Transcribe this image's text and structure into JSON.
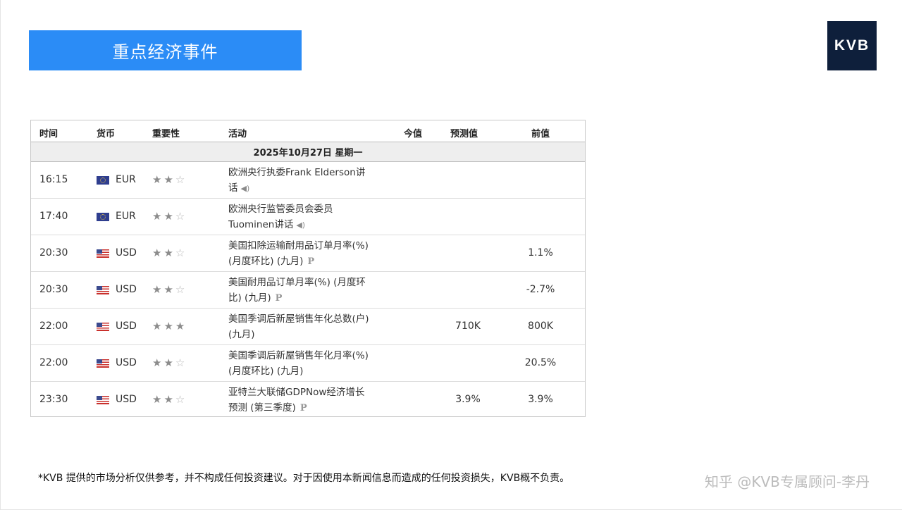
{
  "header": {
    "title": "重点经济事件",
    "logo": "KVB"
  },
  "table": {
    "columns": {
      "time": "时间",
      "currency": "货币",
      "importance": "重要性",
      "event": "活动",
      "actual": "今值",
      "forecast": "预测值",
      "previous": "前值"
    },
    "date": "2025年10月27日  星期一",
    "rows": [
      {
        "time": "16:15",
        "flag": "eu-flag-icon",
        "currency": "EUR",
        "importance": 2,
        "line1": "欧洲央行执委Frank Elderson讲",
        "line2": "话",
        "marker": "speaker-icon",
        "actual": "",
        "forecast": "",
        "previous": ""
      },
      {
        "time": "17:40",
        "flag": "eu-flag-icon",
        "currency": "EUR",
        "importance": 2,
        "line1": "欧洲央行监管委员会委员",
        "line2": "Tuominen讲话",
        "marker": "speaker-icon",
        "actual": "",
        "forecast": "",
        "previous": ""
      },
      {
        "time": "20:30",
        "flag": "us-flag-icon",
        "currency": "USD",
        "importance": 2,
        "line1": "美国扣除运输耐用品订单月率(%)",
        "line2": "(月度环比) (九月)",
        "marker": "preliminary-icon",
        "actual": "",
        "forecast": "",
        "previous": "1.1%"
      },
      {
        "time": "20:30",
        "flag": "us-flag-icon",
        "currency": "USD",
        "importance": 2,
        "line1": "美国耐用品订单月率(%) (月度环",
        "line2": "比) (九月)",
        "marker": "preliminary-icon",
        "actual": "",
        "forecast": "",
        "previous": "-2.7%"
      },
      {
        "time": "22:00",
        "flag": "us-flag-icon",
        "currency": "USD",
        "importance": 3,
        "line1": "美国季调后新屋销售年化总数(户)",
        "line2": "(九月)",
        "marker": "",
        "actual": "",
        "forecast": "710K",
        "previous": "800K"
      },
      {
        "time": "22:00",
        "flag": "us-flag-icon",
        "currency": "USD",
        "importance": 2,
        "line1": "美国季调后新屋销售年化月率(%)",
        "line2": "(月度环比) (九月)",
        "marker": "",
        "actual": "",
        "forecast": "",
        "previous": "20.5%"
      },
      {
        "time": "23:30",
        "flag": "us-flag-icon",
        "currency": "USD",
        "importance": 2,
        "line1": "亚特兰大联储GDPNow经济增长",
        "line2": "预测 (第三季度)",
        "marker": "preliminary-icon",
        "actual": "",
        "forecast": "3.9%",
        "previous": "3.9%"
      }
    ],
    "marker_glyphs": {
      "speaker-icon": "◀)",
      "preliminary-icon": "P"
    },
    "star_glyph_on": "★",
    "star_glyph_off": "☆"
  },
  "footer": {
    "disclaimer": "*KVB 提供的市场分析仅供参考，并不构成任何投资建议。对于因使用本新闻信息而造成的任何投资损失，KVB概不负责。",
    "watermark": "知乎 @KVB专属顾问-李丹"
  },
  "colors": {
    "banner": "#2b8cf6",
    "logo_bg": "#0e1f3b"
  }
}
